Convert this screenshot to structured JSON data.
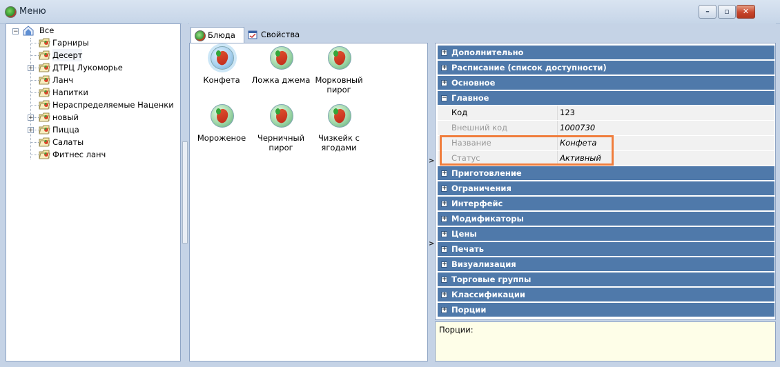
{
  "window": {
    "title": "Меню",
    "icon": "app-tomato-icon",
    "buttons": {
      "minimize": "minimize-icon",
      "maximize": "maximize-icon",
      "close": "close-icon"
    }
  },
  "tree": {
    "root": "Все",
    "items": [
      "Гарниры",
      "Десерт",
      "ДТРЦ Лукоморье",
      "Ланч",
      "Напитки",
      "Нераспределяемые Наценки",
      "новый",
      "Пицца",
      "Салаты",
      "Фитнес ланч"
    ],
    "selected": "Десерт"
  },
  "tabs": [
    {
      "label": "Блюда",
      "icon": "dish-icon",
      "active": true
    },
    {
      "label": "Свойства",
      "icon": "properties-icon",
      "active": false
    }
  ],
  "dishes": [
    {
      "label": "Конфета",
      "selected": true
    },
    {
      "label": "Ложка джема"
    },
    {
      "label": "Морковный пирог"
    },
    {
      "label": "Мороженое"
    },
    {
      "label": "Черничный пирог"
    },
    {
      "label": "Чизкейк с ягодами"
    }
  ],
  "properties": {
    "cat_extra": "Дополнительно",
    "cat_schedule": "Расписание (список доступности)",
    "cat_basic": "Основное",
    "cat_main": "Главное",
    "rows": [
      {
        "name": "Код",
        "value": "123"
      },
      {
        "name": "Внешний код",
        "value": "1000730"
      },
      {
        "name": "Название",
        "value": "Конфета"
      },
      {
        "name": "Статус",
        "value": "Активный"
      }
    ],
    "cats_after": [
      "Приготовление",
      "Ограничения",
      "Интерфейс",
      "Модификаторы",
      "Цены",
      "Печать",
      "Визуализация",
      "Торговые группы",
      "Классификации",
      "Порции"
    ]
  },
  "description": {
    "text": "Порции:"
  },
  "colors": {
    "category": "#4f79aa",
    "highlight": "#f07d3c",
    "background": "#c5d3e6"
  }
}
